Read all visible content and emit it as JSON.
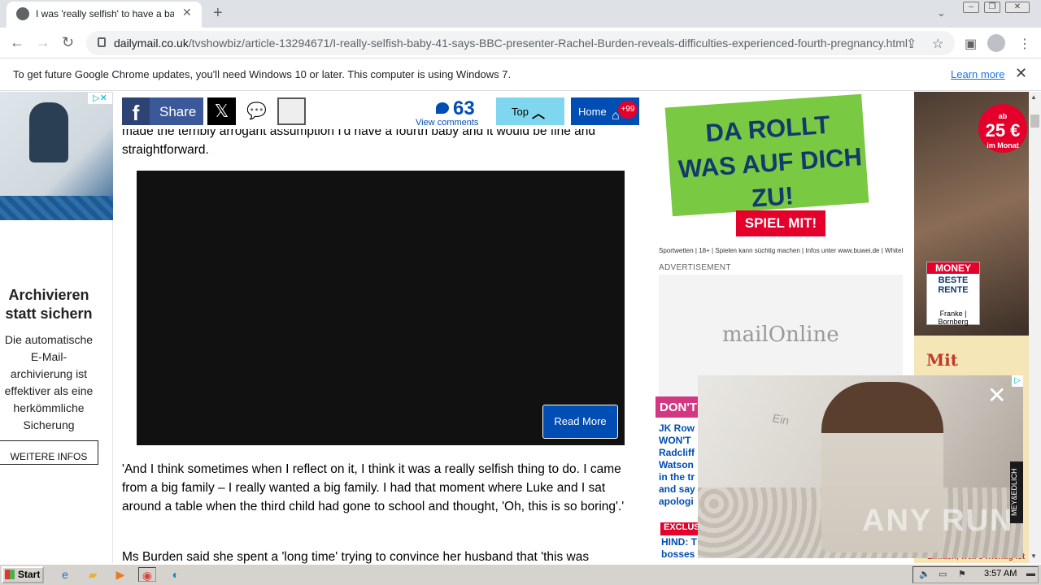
{
  "browser": {
    "tab_title": "I was 'really selfish' to have a baby",
    "new_tab_symbol": "+",
    "url_host": "dailymail.co.uk",
    "url_path": "/tvshowbiz/article-13294671/I-really-selfish-baby-41-says-BBC-presenter-Rachel-Burden-reveals-difficulties-experienced-fourth-pregnancy.html",
    "infobar_text": "To get future Google Chrome updates, you'll need Windows 10 or later. This computer is using Windows 7.",
    "infobar_link": "Learn more"
  },
  "share_bar": {
    "share_label": "Share",
    "comment_count": "63",
    "comment_link": "View comments",
    "top_label": "Top",
    "home_label": "Home",
    "home_badge": "+99"
  },
  "article": {
    "para1": "made the terribly arrogant assumption I'd have a fourth baby and it would be fine and straightforward.",
    "read_more": "Read More",
    "para2": "'And I think sometimes when I reflect on it, I think it was a really selfish thing to do. I came from a big family – I really wanted a big family. I had that moment where Luke and I sat around a table when the third child had gone to school and thought, 'Oh, this is so boring'.'",
    "para3": "Ms Burden said she spent a 'long time' trying to convince her husband that 'this was"
  },
  "left_ad": {
    "title": "Archivieren statt sichern",
    "text": "Die automatische E-Mail-archivierung ist effektiver als eine herkömmliche Sicherung",
    "button": "WEITERE INFOS"
  },
  "right_ads": {
    "green_headline": "DA ROLLT WAS AUF DICH ZU!",
    "green_cta": "SPIEL MIT!",
    "green_legal": "Sportwetten | 18+ | Spielen kann süchtig machen | Infos unter www.buwei.de | Whitelist",
    "advertisement_label": "ADVERTISEMENT",
    "mail_logo": "mailOnline",
    "dont_miss": "DON'T",
    "dont_list": "JK Row WON'T Radcliff Watson in the tr and say apologi",
    "exclusive": "EXCLUS",
    "hind_text": "HIND: T bosses"
  },
  "far_ad": {
    "price_small": "ab",
    "price": "25 €",
    "price_unit": "im Monat",
    "money_head": "MONEY",
    "money_title": "BESTE RENTE",
    "money_brand": "Franke | Bornberg",
    "mit_text": "Mit",
    "bottom_text": "Einfach, weil's wichtig ist"
  },
  "overlay_ad": {
    "brand": "MEY&EDLICH",
    "wall_text": "Ein",
    "watermark": "ANY RUN"
  },
  "taskbar": {
    "start": "Start",
    "clock": "3:57 AM"
  }
}
